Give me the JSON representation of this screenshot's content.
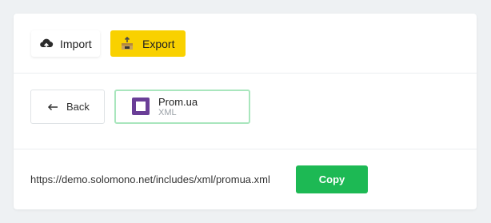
{
  "toolbar": {
    "import_label": "Import",
    "export_label": "Export"
  },
  "nav": {
    "back_label": "Back"
  },
  "format": {
    "name": "Prom.ua",
    "type": "XML"
  },
  "export_link": {
    "url": "https://demo.solomono.net/includes/xml/promua.xml",
    "copy_label": "Copy"
  },
  "colors": {
    "export_button": "#f9d100",
    "copy_button": "#1db954",
    "selected_border": "#a9e6bd",
    "prom_logo": "#6a3e97"
  },
  "icons": {
    "import": "cloud-upload-icon",
    "export": "package-export-icon",
    "back": "arrow-left-icon",
    "format": "prom-logo"
  }
}
